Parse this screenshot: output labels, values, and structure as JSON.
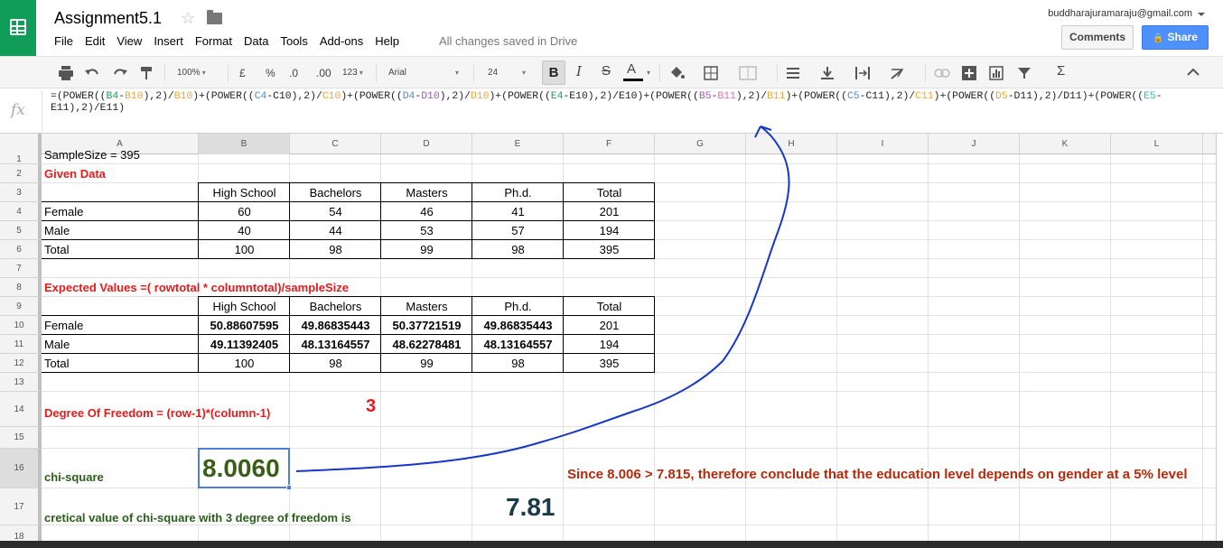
{
  "header": {
    "doc_title": "Assignment5.1",
    "star": "☆",
    "account": "buddharajuramaraju@gmail.com",
    "comments_label": "Comments",
    "share_label": "Share",
    "share_icon": "🔒",
    "saved_status": "All changes saved in Drive",
    "menu": [
      "File",
      "Edit",
      "View",
      "Insert",
      "Format",
      "Data",
      "Tools",
      "Add-ons",
      "Help"
    ]
  },
  "toolbar": {
    "zoom": "100%",
    "currency": "£",
    "percent": "%",
    "dec_less": ".0",
    "dec_more": ".00",
    "more_formats": "123",
    "font": "Arial",
    "font_size": "24",
    "bold": "B",
    "italic": "I",
    "strike": "S",
    "text_color": "A",
    "function": "Σ",
    "collapse": "^"
  },
  "formula_bar": {
    "fx": "fx",
    "parts": [
      {
        "t": "=(POWER(("
      },
      {
        "t": "B4",
        "c": "green"
      },
      {
        "t": "-"
      },
      {
        "t": "B10",
        "c": "orange"
      },
      {
        "t": "),2)/"
      },
      {
        "t": "B10",
        "c": "orange"
      },
      {
        "t": ")+(POWER(("
      },
      {
        "t": "C4",
        "c": "blue"
      },
      {
        "t": "-C10),2)/"
      },
      {
        "t": "C10",
        "c": "orange"
      },
      {
        "t": ")+(POWER(("
      },
      {
        "t": "D4",
        "c": "blue"
      },
      {
        "t": "-"
      },
      {
        "t": "D10",
        "c": "purple"
      },
      {
        "t": "),2)/"
      },
      {
        "t": "D10",
        "c": "orange"
      },
      {
        "t": ")+(POWER(("
      },
      {
        "t": "E4",
        "c": "green"
      },
      {
        "t": "-E10),2)/E10)+(POWER(("
      },
      {
        "t": "B5",
        "c": "purple"
      },
      {
        "t": "-"
      },
      {
        "t": "B11",
        "c": "pink"
      },
      {
        "t": "),2)/"
      },
      {
        "t": "B11",
        "c": "orange"
      },
      {
        "t": ")+(POWER(("
      },
      {
        "t": "C5",
        "c": "blue"
      },
      {
        "t": "-C11),2)/"
      },
      {
        "t": "C11",
        "c": "orange"
      },
      {
        "t": ")+(POWER(("
      },
      {
        "t": "D5",
        "c": "orange"
      },
      {
        "t": "-D11),2)/D11)+(POWER(("
      },
      {
        "t": "E5",
        "c": "teal"
      },
      {
        "t": "-\nE11),2)/E11)"
      }
    ]
  },
  "columns": [
    "A",
    "B",
    "C",
    "D",
    "E",
    "F",
    "G",
    "H",
    "I",
    "J",
    "K",
    "L"
  ],
  "rows": [
    "1",
    "2",
    "3",
    "4",
    "5",
    "6",
    "7",
    "8",
    "9",
    "10",
    "11",
    "12",
    "13",
    "14",
    "15",
    "16",
    "17",
    "18"
  ],
  "sheet": {
    "sample_size": "SampleSize = 395",
    "given_data_title": "Given Data",
    "given_headers": [
      "High School",
      "Bachelors",
      "Masters",
      "Ph.d.",
      "Total"
    ],
    "given_rows": [
      {
        "label": "Female",
        "values": [
          "60",
          "54",
          "46",
          "41",
          "201"
        ]
      },
      {
        "label": "Male",
        "values": [
          "40",
          "44",
          "53",
          "57",
          "194"
        ]
      },
      {
        "label": "Total",
        "values": [
          "100",
          "98",
          "99",
          "98",
          "395"
        ]
      }
    ],
    "expected_title": "Expected Values =( rowtotal * columntotal)/sampleSize",
    "expected_headers": [
      "High School",
      "Bachelors",
      "Masters",
      "Ph.d.",
      "Total"
    ],
    "expected_rows": [
      {
        "label": "Female",
        "values": [
          "50.88607595",
          "49.86835443",
          "50.37721519",
          "49.86835443",
          "201"
        ]
      },
      {
        "label": "Male",
        "values": [
          "49.11392405",
          "48.13164557",
          "48.62278481",
          "48.13164557",
          "194"
        ]
      },
      {
        "label": "Total",
        "values": [
          "100",
          "98",
          "99",
          "98",
          "395"
        ]
      }
    ],
    "dof_label": "Degree Of Freedom = (row-1)*(column-1)",
    "dof_value": "3",
    "chi_label": "chi-square",
    "chi_value": "8.0060",
    "conclusion": "Since 8.006 > 7.815, therefore  conclude that the education level depends on gender at a 5% level",
    "critical_label": "cretical value of chi-square with 3 degree of freedom is",
    "critical_value": "7.81"
  },
  "colors": {
    "sheets_green": "#0f9d58",
    "share_blue": "#4d90fe",
    "red_label": "#e31c1c",
    "dark_green": "#2a5e1a",
    "conclusion_red": "#b52a0c",
    "critical_teal": "#1a3a4a",
    "annotation_blue": "#1536c8"
  }
}
